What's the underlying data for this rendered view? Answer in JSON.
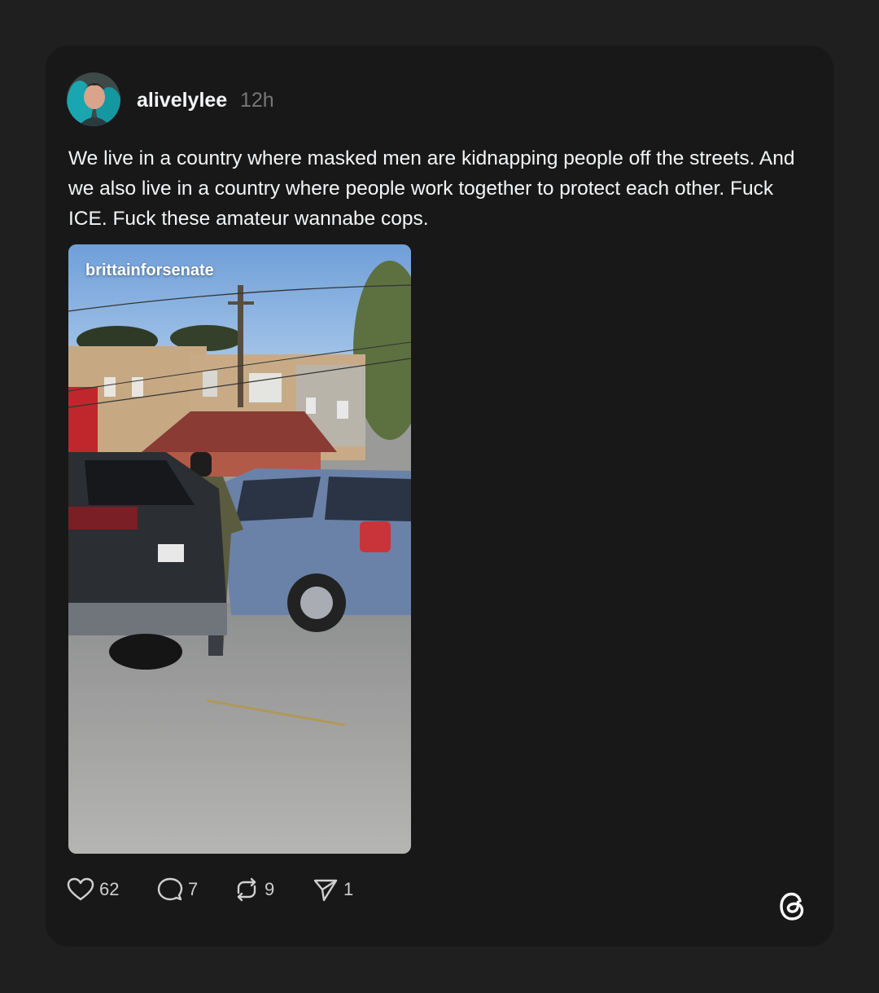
{
  "post": {
    "username": "alivelylee",
    "time": "12h",
    "text": "We live in a country where masked men are kidnapping people off the streets. And we also live in a country where people work together to protect each other. Fuck ICE. Fuck these amateur wannabe cops.",
    "media_handle": "brittainforsenate"
  },
  "actions": {
    "likes": "62",
    "replies": "7",
    "reposts": "9",
    "shares": "1"
  },
  "icons": {
    "like": "heart-icon",
    "reply": "comment-icon",
    "repost": "repost-icon",
    "share": "send-icon",
    "brand": "threads-logo-icon"
  },
  "colors": {
    "background": "#1f1f1f",
    "card": "#181818",
    "text": "#f3f5f7",
    "muted": "#777777"
  }
}
